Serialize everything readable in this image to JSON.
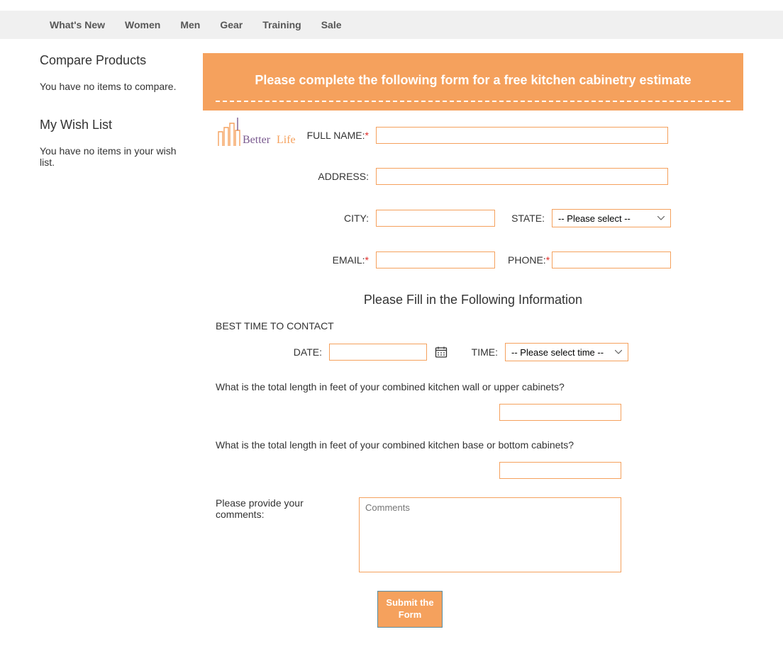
{
  "nav": {
    "items": [
      {
        "label": "What's New"
      },
      {
        "label": "Women"
      },
      {
        "label": "Men"
      },
      {
        "label": "Gear"
      },
      {
        "label": "Training"
      },
      {
        "label": "Sale"
      }
    ]
  },
  "sidebar": {
    "compare": {
      "title": "Compare Products",
      "text": "You have no items to compare."
    },
    "wishlist": {
      "title": "My Wish List",
      "text": "You have no items in your wish list."
    }
  },
  "banner": {
    "title": "Please complete the following form for a free kitchen cabinetry estimate"
  },
  "logo": {
    "text": "Better Life"
  },
  "form": {
    "full_name": {
      "label": "FULL NAME:",
      "required": "*"
    },
    "address": {
      "label": "ADDRESS:"
    },
    "city": {
      "label": "CITY:"
    },
    "state": {
      "label": "STATE:",
      "placeholder": "-- Please select --"
    },
    "email": {
      "label": "EMAIL:",
      "required": "*"
    },
    "phone": {
      "label": "PHONE:",
      "required": "*"
    },
    "section_title": "Please Fill in the Following Information",
    "best_time": "BEST TIME TO CONTACT",
    "date": {
      "label": "DATE:"
    },
    "time": {
      "label": "TIME:",
      "placeholder": "-- Please select time --"
    },
    "q1": "What is the total length in feet of your combined kitchen wall or upper cabinets?",
    "q2": "What is the total length in feet of your combined kitchen base or bottom cabinets?",
    "comments": {
      "label": "Please provide your comments:",
      "placeholder": "Comments"
    },
    "submit": "Submit the Form"
  }
}
